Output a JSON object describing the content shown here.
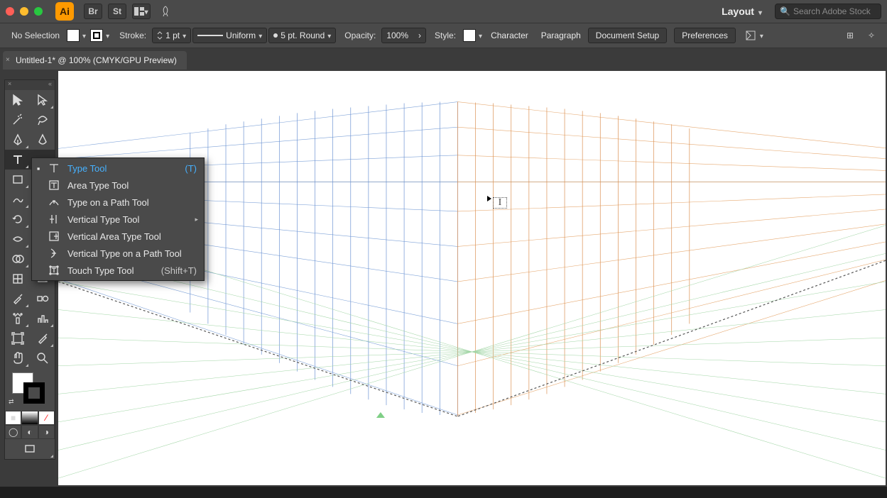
{
  "top": {
    "workspace_label": "Layout",
    "search_placeholder": "Search Adobe Stock",
    "br_label": "Br",
    "st_label": "St"
  },
  "control": {
    "no_selection": "No Selection",
    "stroke_label": "Stroke:",
    "stroke_weight": "1 pt",
    "stroke_profile": "Uniform",
    "brush": "5 pt. Round",
    "opacity_label": "Opacity:",
    "opacity_value": "100%",
    "style_label": "Style:",
    "character": "Character",
    "paragraph": "Paragraph",
    "document_setup": "Document Setup",
    "preferences": "Preferences"
  },
  "tab": {
    "title": "Untitled-1* @ 100% (CMYK/GPU Preview)"
  },
  "flyout": {
    "items": [
      {
        "label": "Type Tool",
        "shortcut": "(T)",
        "selected": true,
        "icon": "type"
      },
      {
        "label": "Area Type Tool",
        "shortcut": "",
        "selected": false,
        "icon": "area-type"
      },
      {
        "label": "Type on a Path Tool",
        "shortcut": "",
        "selected": false,
        "icon": "path-type"
      },
      {
        "label": "Vertical Type Tool",
        "shortcut": "",
        "selected": false,
        "icon": "vtype",
        "submenu": true
      },
      {
        "label": "Vertical Area Type Tool",
        "shortcut": "",
        "selected": false,
        "icon": "varea"
      },
      {
        "label": "Vertical Type on a Path Tool",
        "shortcut": "",
        "selected": false,
        "icon": "vpath"
      },
      {
        "label": "Touch Type Tool",
        "shortcut": "(Shift+T)",
        "selected": false,
        "icon": "touch"
      }
    ]
  }
}
